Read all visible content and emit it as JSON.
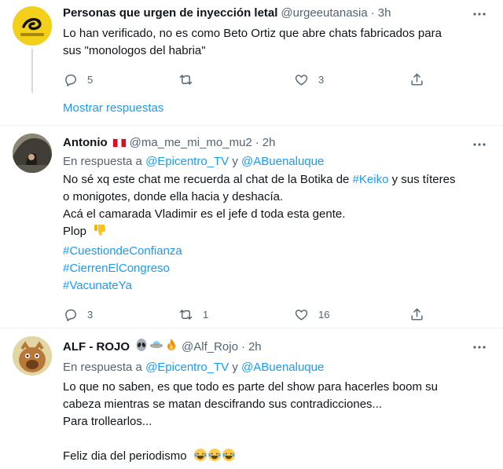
{
  "tweets": [
    {
      "name": "Personas que urgen de inyección letal",
      "handle": "@urgeeutanasia",
      "separator": "·",
      "time": "3h",
      "lines": [
        "Lo han verificado, no es como Beto Ortiz que abre chats fabricados para",
        "sus \"monologos del habria\""
      ],
      "counts": {
        "reply": "5",
        "retweet": "",
        "like": "3"
      },
      "avatar_text": "NO TREAD ON ME"
    },
    {
      "name": "Antonio",
      "name_emoji": "peru-flag",
      "handle": "@ma_me_mi_mo_mu2",
      "separator": "·",
      "time": "2h",
      "reply_prefix": "En respuesta a",
      "reply_user1": "@Epicentro_TV",
      "reply_and": "y",
      "reply_user2": "@ABuenaluque",
      "line1_a": "No sé  xq este chat me recuerda al chat de la Botika de ",
      "line1_tag": "#Keiko",
      "line1_b": " y sus títeres",
      "line2": "o monigotes, donde ella hacia  y deshacía.",
      "line3": "Acá el camarada Vladimir es el jefe d toda esta gente.",
      "line4": "Plop",
      "hashtags": [
        "#CuestiondeConfianza",
        "#CierrenElCongreso",
        "#VacunateYa"
      ],
      "counts": {
        "reply": "3",
        "retweet": "1",
        "like": "16"
      }
    },
    {
      "name": "ALF - ROJO",
      "handle": "@Alf_Rojo",
      "separator": "·",
      "time": "2h",
      "reply_prefix": "En respuesta a",
      "reply_user1": "@Epicentro_TV",
      "reply_and": "y",
      "reply_user2": "@ABuenaluque",
      "lines": [
        "Lo que no saben, es que todo es parte del show para hacerles boom su",
        "cabeza mientras se matan descifrando sus contradicciones...",
        "Para trollearlos...",
        "",
        "Feliz dia del periodismo"
      ]
    }
  ],
  "show_replies": "Mostrar respuestas",
  "colors": {
    "accent": "#1d9bf0",
    "muted": "#536471",
    "border": "#eff3f4"
  }
}
